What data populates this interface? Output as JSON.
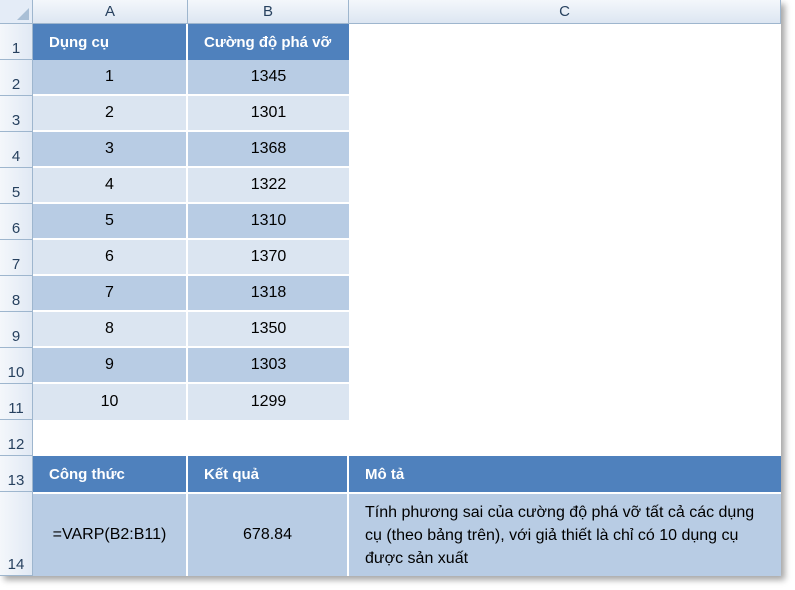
{
  "columns": [
    "A",
    "B",
    "C"
  ],
  "rows": [
    "1",
    "2",
    "3",
    "4",
    "5",
    "6",
    "7",
    "8",
    "9",
    "10",
    "11",
    "12",
    "13",
    "14"
  ],
  "table": {
    "header_a": "Dụng cụ",
    "header_b": "Cường độ phá vỡ",
    "data": [
      {
        "a": "1",
        "b": "1345"
      },
      {
        "a": "2",
        "b": "1301"
      },
      {
        "a": "3",
        "b": "1368"
      },
      {
        "a": "4",
        "b": "1322"
      },
      {
        "a": "5",
        "b": "1310"
      },
      {
        "a": "6",
        "b": "1370"
      },
      {
        "a": "7",
        "b": "1318"
      },
      {
        "a": "8",
        "b": "1350"
      },
      {
        "a": "9",
        "b": "1303"
      },
      {
        "a": "10",
        "b": "1299"
      }
    ]
  },
  "formula_table": {
    "header_formula": "Công thức",
    "header_result": "Kết quả",
    "header_desc": "Mô tả",
    "formula": "=VARP(B2:B11)",
    "result": "678.84",
    "description": "Tính phương sai của cường độ phá vỡ tất cả các dụng cụ (theo bảng trên), với giả thiết là chỉ có 10 dụng cụ được sản xuất"
  },
  "colors": {
    "header_blue": "#4f81bd",
    "band_dark": "#b8cce4",
    "band_light": "#dbe5f1"
  }
}
